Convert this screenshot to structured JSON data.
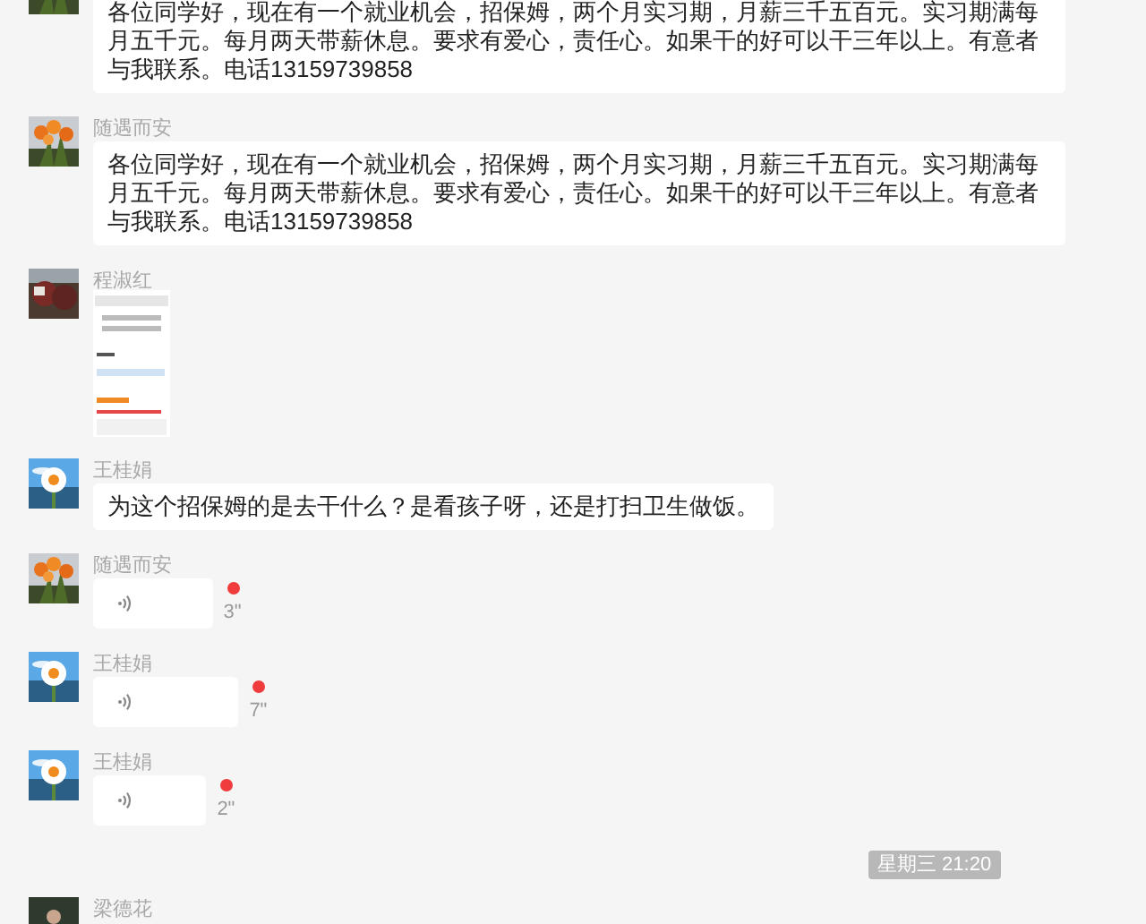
{
  "messages": [
    {
      "kind": "text",
      "text": "各位同学好，现在有一个就业机会，招保姆，两个月实习期，月薪三千五百元。实习期满每月五千元。每月两天带薪休息。要求有爱心，责任心。如果干的好可以干三年以上。有意者与我联系。电话13159739858"
    },
    {
      "kind": "text",
      "name": "随遇而安",
      "text": "各位同学好，现在有一个就业机会，招保姆，两个月实习期，月薪三千五百元。实习期满每月五千元。每月两天带薪休息。要求有爱心，责任心。如果干的好可以干三年以上。有意者与我联系。电话13159739858"
    },
    {
      "name": "程淑红"
    },
    {
      "kind": "text",
      "name": "王桂娟",
      "text": "为这个招保姆的是去干什么？是看孩子呀，还是打扫卫生做饭。"
    },
    {
      "kind": "voice",
      "name": "随遇而安",
      "duration": "3\"",
      "unread": true
    },
    {
      "kind": "voice",
      "name": "王桂娟",
      "duration": "7\"",
      "unread": true
    },
    {
      "kind": "voice",
      "name": "王桂娟",
      "duration": "2\"",
      "unread": true
    },
    {
      "kind": "timestamp",
      "text": "星期三 21:20"
    },
    {
      "kind": "cut",
      "name": "梁德花"
    }
  ]
}
